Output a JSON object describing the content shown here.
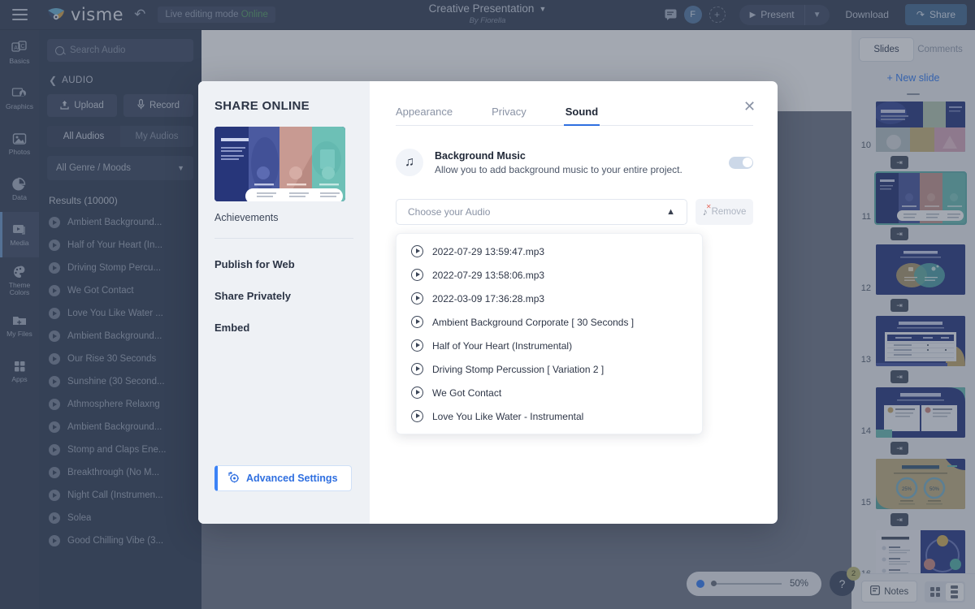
{
  "topbar": {
    "menu_icon": "hamburger-icon",
    "brand": "visme",
    "undo_icon": "undo-icon",
    "live_mode_label": "Live editing mode",
    "live_status": "Online",
    "doc_title": "Creative Presentation",
    "doc_author": "By Fiorella",
    "comment_icon": "comment-icon",
    "avatar_initial": "F",
    "add_collaborator_icon": "plus-icon",
    "present_label": "Present",
    "present_caret_icon": "chevron-down-icon",
    "download_label": "Download",
    "share_label": "Share",
    "share_icon": "share-arrow-icon"
  },
  "rail": {
    "items": [
      {
        "label": "Basics",
        "icon": "basics-icon",
        "active": false
      },
      {
        "label": "Graphics",
        "icon": "graphics-icon",
        "active": false
      },
      {
        "label": "Photos",
        "icon": "photos-icon",
        "active": false
      },
      {
        "label": "Data",
        "icon": "data-icon",
        "active": false
      },
      {
        "label": "Media",
        "icon": "media-icon",
        "active": true
      },
      {
        "label": "Theme Colors",
        "icon": "theme-colors-icon",
        "active": false
      },
      {
        "label": "My Files",
        "icon": "my-files-icon",
        "active": false
      },
      {
        "label": "Apps",
        "icon": "apps-icon",
        "active": false
      }
    ]
  },
  "audio_panel": {
    "search_placeholder": "Search Audio",
    "search_value": "",
    "search_icon": "search-icon",
    "back_icon": "chevron-left-icon",
    "section_title": "AUDIO",
    "upload_label": "Upload",
    "upload_icon": "upload-icon",
    "record_label": "Record",
    "record_icon": "microphone-icon",
    "tabs": [
      {
        "label": "All Audios",
        "active": true
      },
      {
        "label": "My Audios",
        "active": false
      }
    ],
    "genre_label": "All Genre / Moods",
    "genre_caret_icon": "chevron-down-icon",
    "results_label": "Results (10000)",
    "tracks": [
      "Ambient Background...",
      "Half of Your Heart (In...",
      "Driving Stomp Percu...",
      "We Got Contact",
      "Love You Like Water ...",
      "Ambient Background...",
      "Our Rise 30 Seconds",
      "Sunshine (30 Second...",
      "Athmosphere Relaxng",
      "Ambient Background...",
      "Stomp and Claps Ene...",
      "Breakthrough (No M...",
      "Night Call (Instrumen...",
      "Solea",
      "Good Chilling Vibe (3..."
    ]
  },
  "modal": {
    "title": "SHARE ONLINE",
    "close_icon": "close-icon",
    "preview_name": "Achievements",
    "nav_links": [
      "Publish for Web",
      "Share Privately",
      "Embed"
    ],
    "advanced_settings_label": "Advanced Settings",
    "advanced_settings_icon": "settings-gear-icon",
    "tabs": [
      {
        "label": "Appearance",
        "active": false
      },
      {
        "label": "Privacy",
        "active": false
      },
      {
        "label": "Sound",
        "active": true
      }
    ],
    "background_music": {
      "icon": "music-note-icon",
      "title": "Background Music",
      "description": "Allow you to add background music to your entire project.",
      "toggle_on": false
    },
    "choose_audio_placeholder": "Choose your Audio",
    "choose_audio_value": "",
    "choose_caret_icon": "chevron-up-icon",
    "remove_label": "Remove",
    "remove_icon": "music-note-remove-icon",
    "dropdown_items": [
      "2022-07-29 13:59:47.mp3",
      "2022-07-29 13:58:06.mp3",
      "2022-03-09 17:36:28.mp3",
      "Ambient Background Corporate [ 30 Seconds ]",
      "Half of Your Heart (Instrumental)",
      "Driving Stomp Percussion [ Variation 2 ]",
      "We Got Contact",
      "Love You Like Water - Instrumental"
    ]
  },
  "zoom_bar": {
    "percent": "50%",
    "help_icon": "question-mark-icon",
    "help_badge": "2"
  },
  "slides_panel": {
    "tabs": [
      {
        "label": "Slides",
        "active": true
      },
      {
        "label": "Comments",
        "active": false
      }
    ],
    "new_slide_label": "+ New slide",
    "slides": [
      {
        "number": "10",
        "title": "PORTFOLIO",
        "selected": false
      },
      {
        "number": "11",
        "title": "Achievements",
        "selected": true
      },
      {
        "number": "12",
        "title": "Venn Diagram",
        "selected": false
      },
      {
        "number": "13",
        "title": "Product Comparison",
        "selected": false
      },
      {
        "number": "14",
        "title": "PROS & CONS",
        "selected": false
      },
      {
        "number": "15",
        "title": "STATISTICS",
        "selected": false
      },
      {
        "number": "16",
        "title": "3-Steps Process",
        "selected": false
      }
    ],
    "transition_icon": "transition-arrow-icon",
    "notes_label": "Notes",
    "notes_icon": "notes-icon",
    "grid_view_icon": "grid-view-icon",
    "list_view_icon": "list-view-icon"
  },
  "colors": {
    "accent_blue": "#2f6fe0",
    "brand_dark": "#3b465c",
    "panel_dark": "#38445a",
    "canvas": "#737b8a",
    "online_green": "#5ca36a"
  }
}
